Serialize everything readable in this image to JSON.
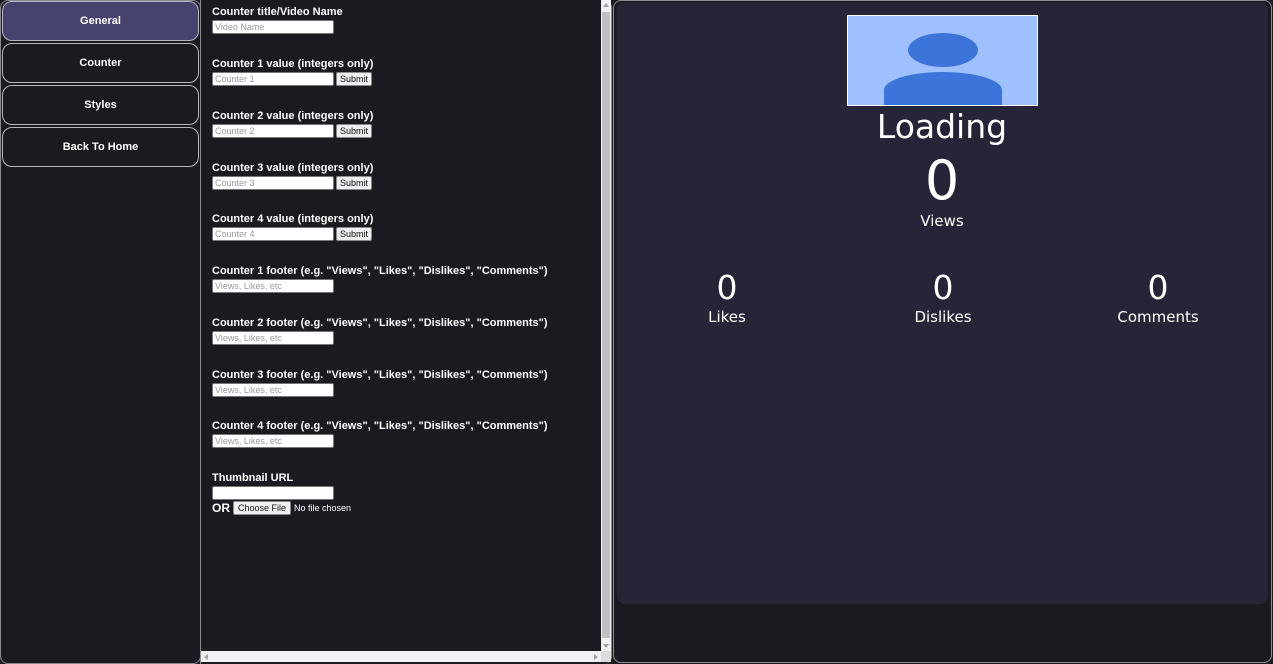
{
  "sidebar": {
    "items": [
      {
        "label": "General",
        "active": true
      },
      {
        "label": "Counter",
        "active": false
      },
      {
        "label": "Styles",
        "active": false
      },
      {
        "label": "Back To Home",
        "active": false
      }
    ]
  },
  "settings": {
    "title_field": {
      "label": "Counter title/Video Name",
      "placeholder": "Video Name"
    },
    "counters": [
      {
        "label": "Counter 1 value (integers only)",
        "placeholder": "Counter 1",
        "button": "Submit"
      },
      {
        "label": "Counter 2 value (integers only)",
        "placeholder": "Counter 2",
        "button": "Submit"
      },
      {
        "label": "Counter 3 value (integers only)",
        "placeholder": "Counter 3",
        "button": "Submit"
      },
      {
        "label": "Counter 4 value (integers only)",
        "placeholder": "Counter 4",
        "button": "Submit"
      }
    ],
    "footers": [
      {
        "label": "Counter 1 footer (e.g. \"Views\", \"Likes\", \"Dislikes\", \"Comments\")",
        "placeholder": "Views, Likes, etc"
      },
      {
        "label": "Counter 2 footer (e.g. \"Views\", \"Likes\", \"Dislikes\", \"Comments\")",
        "placeholder": "Views, Likes, etc"
      },
      {
        "label": "Counter 3 footer (e.g. \"Views\", \"Likes\", \"Dislikes\", \"Comments\")",
        "placeholder": "Views, Likes, etc"
      },
      {
        "label": "Counter 4 footer (e.g. \"Views\", \"Likes\", \"Dislikes\", \"Comments\")",
        "placeholder": "Views, Likes, etc"
      }
    ],
    "thumbnail": {
      "label": "Thumbnail URL",
      "value": "",
      "or_label": "OR",
      "choose_button": "Choose File",
      "file_status": "No file chosen"
    }
  },
  "preview": {
    "title": "Loading",
    "main_counter": {
      "value": "0",
      "footer": "Views"
    },
    "sub_counters": [
      {
        "value": "0",
        "footer": "Likes"
      },
      {
        "value": "0",
        "footer": "Dislikes"
      },
      {
        "value": "0",
        "footer": "Comments"
      }
    ]
  },
  "colors": {
    "background": "#1b1a21",
    "active_nav": "#46446f",
    "preview_card": "#262537",
    "thumbnail_bg": "#9fc0ff",
    "avatar": "#3d74d9"
  }
}
